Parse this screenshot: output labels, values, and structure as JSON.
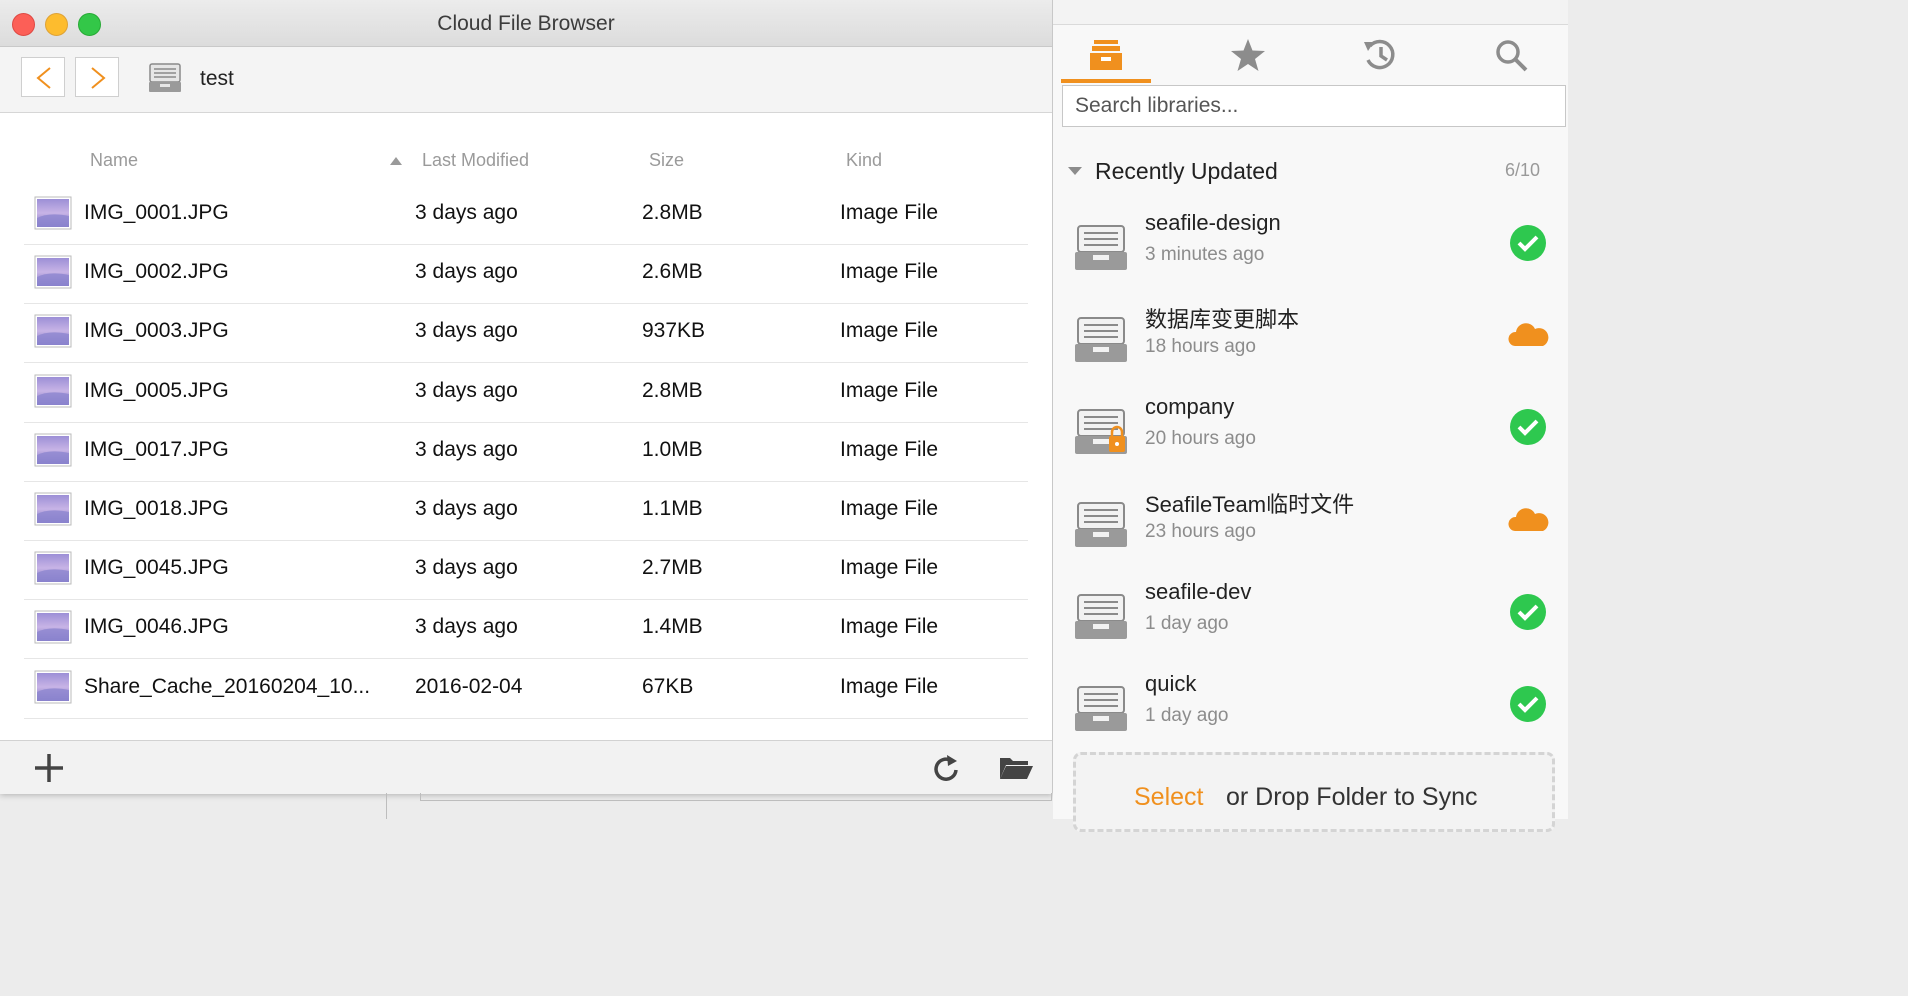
{
  "window": {
    "title": "Cloud File Browser"
  },
  "toolbar": {
    "path": "test"
  },
  "columns": {
    "name": "Name",
    "modified": "Last Modified",
    "size": "Size",
    "kind": "Kind"
  },
  "files": [
    {
      "name": "IMG_0001.JPG",
      "modified": "3 days ago",
      "size": "2.8MB",
      "kind": "Image File"
    },
    {
      "name": "IMG_0002.JPG",
      "modified": "3 days ago",
      "size": "2.6MB",
      "kind": "Image File"
    },
    {
      "name": "IMG_0003.JPG",
      "modified": "3 days ago",
      "size": "937KB",
      "kind": "Image File"
    },
    {
      "name": "IMG_0005.JPG",
      "modified": "3 days ago",
      "size": "2.8MB",
      "kind": "Image File"
    },
    {
      "name": "IMG_0017.JPG",
      "modified": "3 days ago",
      "size": "1.0MB",
      "kind": "Image File"
    },
    {
      "name": "IMG_0018.JPG",
      "modified": "3 days ago",
      "size": "1.1MB",
      "kind": "Image File"
    },
    {
      "name": "IMG_0045.JPG",
      "modified": "3 days ago",
      "size": "2.7MB",
      "kind": "Image File"
    },
    {
      "name": "IMG_0046.JPG",
      "modified": "3 days ago",
      "size": "1.4MB",
      "kind": "Image File"
    },
    {
      "name": "Share_Cache_20160204_10...",
      "modified": "2016-02-04",
      "size": "67KB",
      "kind": "Image File"
    }
  ],
  "panel": {
    "search_placeholder": "Search libraries...",
    "section_title": "Recently Updated",
    "section_count": "6/10",
    "libraries": [
      {
        "name": "seafile-design",
        "time": "3 minutes ago",
        "status": "synced"
      },
      {
        "name": "数据库变更脚本",
        "time": "18 hours ago",
        "status": "cloud"
      },
      {
        "name": "company",
        "time": "20 hours ago",
        "status": "synced",
        "locked": true
      },
      {
        "name": "SeafileTeam临时文件",
        "time": "23 hours ago",
        "status": "cloud"
      },
      {
        "name": "seafile-dev",
        "time": "1 day ago",
        "status": "synced"
      },
      {
        "name": "quick",
        "time": "1 day ago",
        "status": "synced"
      }
    ],
    "drop_select": "Select",
    "drop_text": "or Drop Folder to Sync"
  },
  "colors": {
    "accent": "#f0901e",
    "synced": "#2ec84f",
    "cloud": "#f0901e"
  },
  "icons": [
    "back-arrow-icon",
    "forward-arrow-icon",
    "library-icon",
    "image-file-icon",
    "add-icon",
    "refresh-icon",
    "open-folder-icon",
    "library-tab-icon",
    "star-icon",
    "history-icon",
    "search-icon",
    "synced-check-icon",
    "cloud-icon",
    "lock-icon"
  ]
}
